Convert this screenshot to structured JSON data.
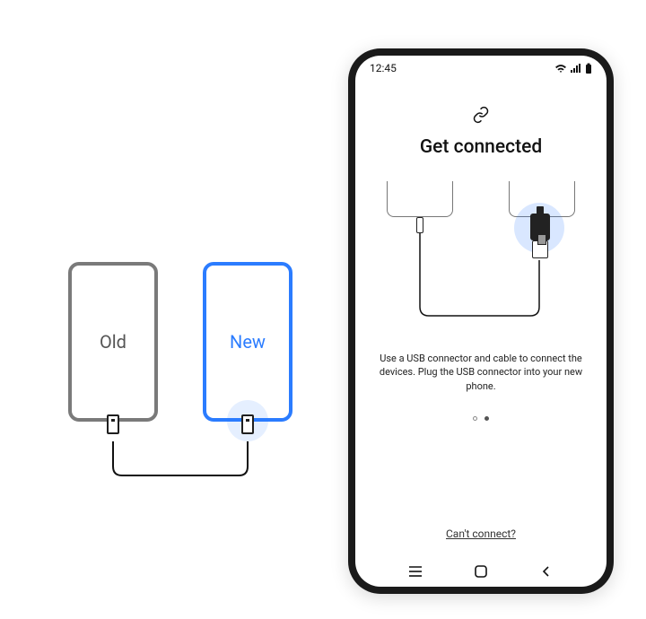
{
  "left": {
    "old_label": "Old",
    "new_label": "New"
  },
  "status": {
    "time": "12:45"
  },
  "page": {
    "title": "Get connected",
    "instruction": "Use a USB connector and cable to connect the devices. Plug the USB connector into your new phone.",
    "cant_connect": "Can't connect?"
  },
  "pagination": {
    "page_count": 2,
    "active_index": 1
  }
}
